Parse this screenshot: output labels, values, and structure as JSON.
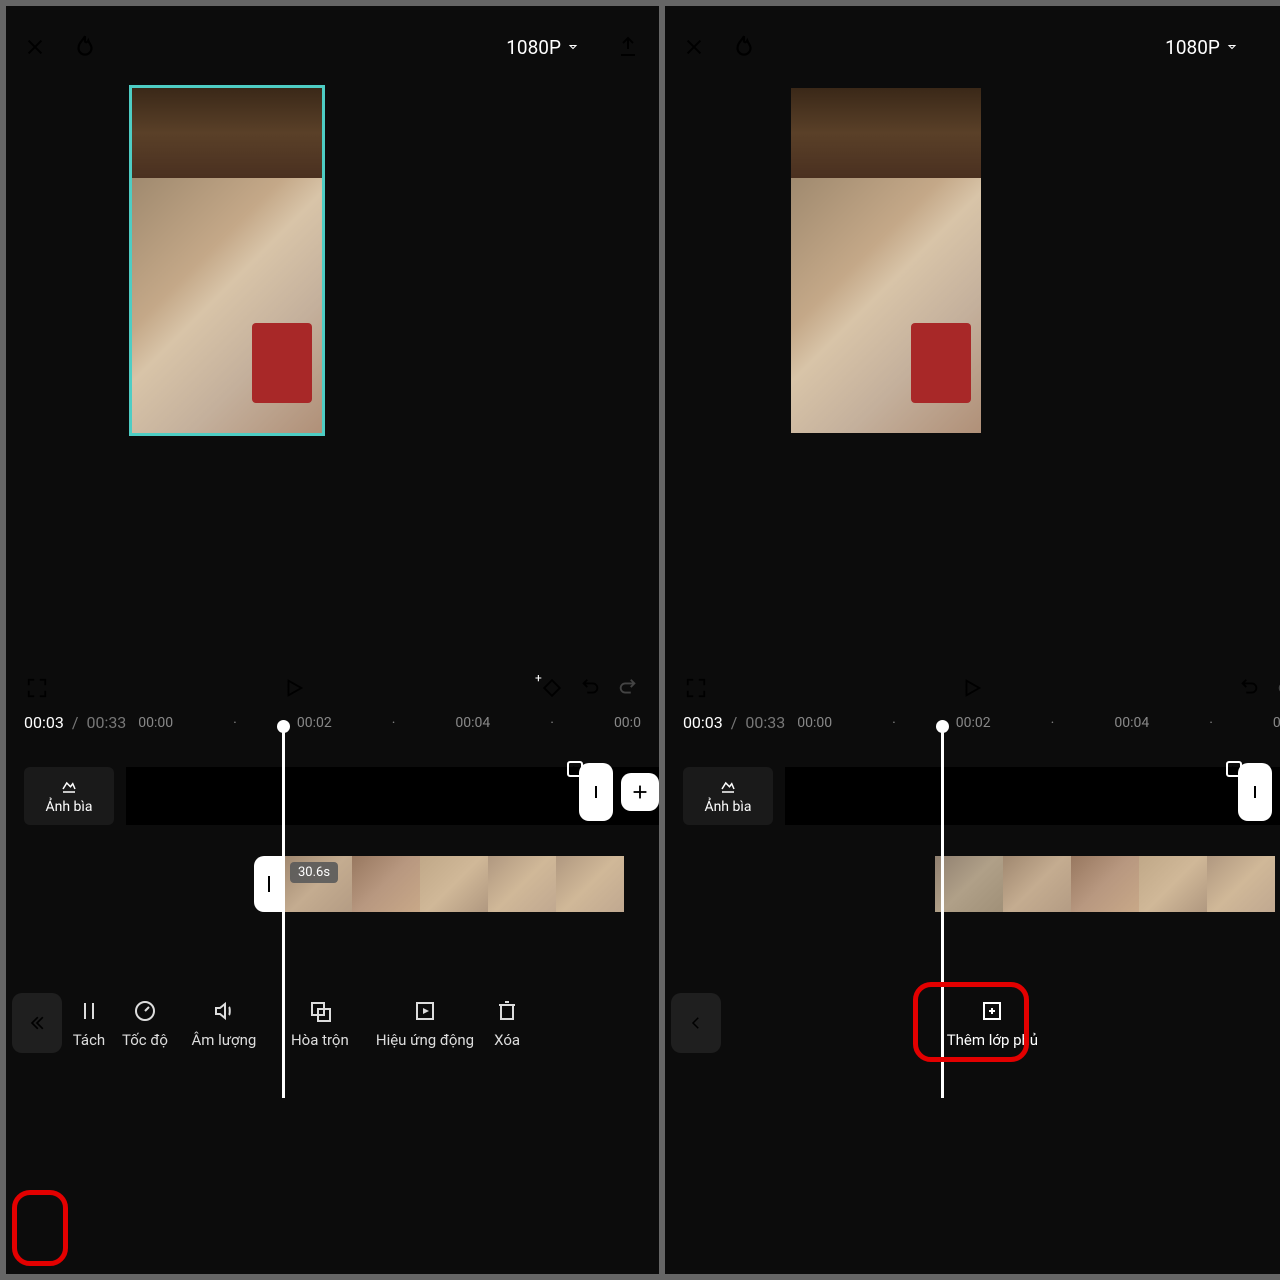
{
  "header": {
    "quality": "1080P"
  },
  "playback": {
    "current": "00:03",
    "total": "00:33"
  },
  "timeline": {
    "marks": [
      "00:00",
      "·",
      "00:02",
      "·",
      "00:04",
      "·",
      "00:0"
    ],
    "cover_label": "Ảnh bìa",
    "clip_duration": "30.6s"
  },
  "tools_left": {
    "split": "Tách",
    "speed": "Tốc độ",
    "volume": "Âm lượng",
    "blend": "Hòa trộn",
    "animation": "Hiệu ứng động",
    "delete": "Xóa"
  },
  "tools_right": {
    "add_overlay": "Thêm lớp phủ"
  }
}
